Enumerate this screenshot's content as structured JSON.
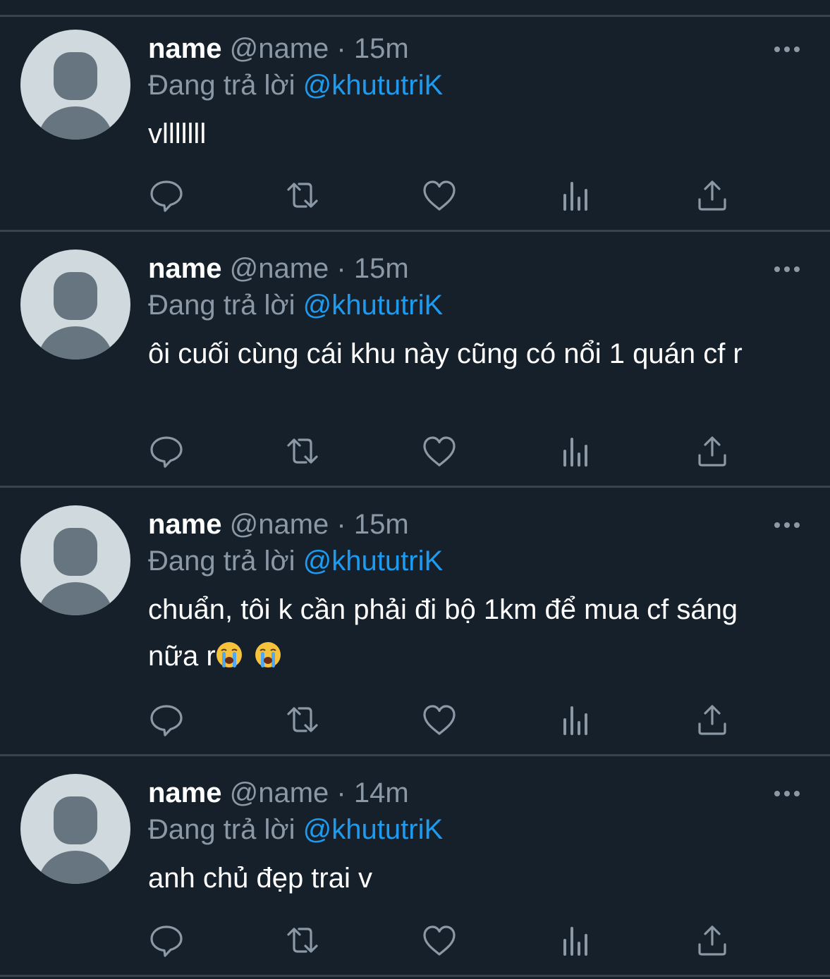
{
  "colors": {
    "background": "#15202b",
    "divider": "#38444d",
    "secondary_text": "#8b98a5",
    "mention": "#1d9bf0",
    "icon": "#8b98a5",
    "avatar_bg": "#cfd9de",
    "avatar_fg": "#66757f"
  },
  "tweets": [
    {
      "author_name": "name",
      "author_handle": "@name",
      "separator": "·",
      "timestamp": "15m",
      "reply_prefix": "Đang trả lời",
      "reply_to": "@khututriK",
      "text": "vlllllll",
      "icons": [
        "reply-icon",
        "retweet-icon",
        "like-icon",
        "analytics-icon",
        "share-icon"
      ]
    },
    {
      "author_name": "name",
      "author_handle": "@name",
      "separator": "·",
      "timestamp": "15m",
      "reply_prefix": "Đang trả lời",
      "reply_to": "@khututriK",
      "text": "ôi cuối cùng cái khu này cũng có nổi 1 quán cf r",
      "icons": [
        "reply-icon",
        "retweet-icon",
        "like-icon",
        "analytics-icon",
        "share-icon"
      ]
    },
    {
      "author_name": "name",
      "author_handle": "@name",
      "separator": "·",
      "timestamp": "15m",
      "reply_prefix": "Đang trả lời",
      "reply_to": "@khututriK",
      "text": "chuẩn, tôi k cần phải đi bộ 1km để mua cf sáng nữa r",
      "emojis": [
        "loudly-crying-face",
        "loudly-crying-face"
      ],
      "icons": [
        "reply-icon",
        "retweet-icon",
        "like-icon",
        "analytics-icon",
        "share-icon"
      ]
    },
    {
      "author_name": "name",
      "author_handle": "@name",
      "separator": "·",
      "timestamp": "14m",
      "reply_prefix": "Đang trả lời",
      "reply_to": "@khututriK",
      "text": "anh chủ đẹp trai v",
      "icons": [
        "reply-icon",
        "retweet-icon",
        "like-icon",
        "analytics-icon",
        "share-icon"
      ]
    }
  ]
}
